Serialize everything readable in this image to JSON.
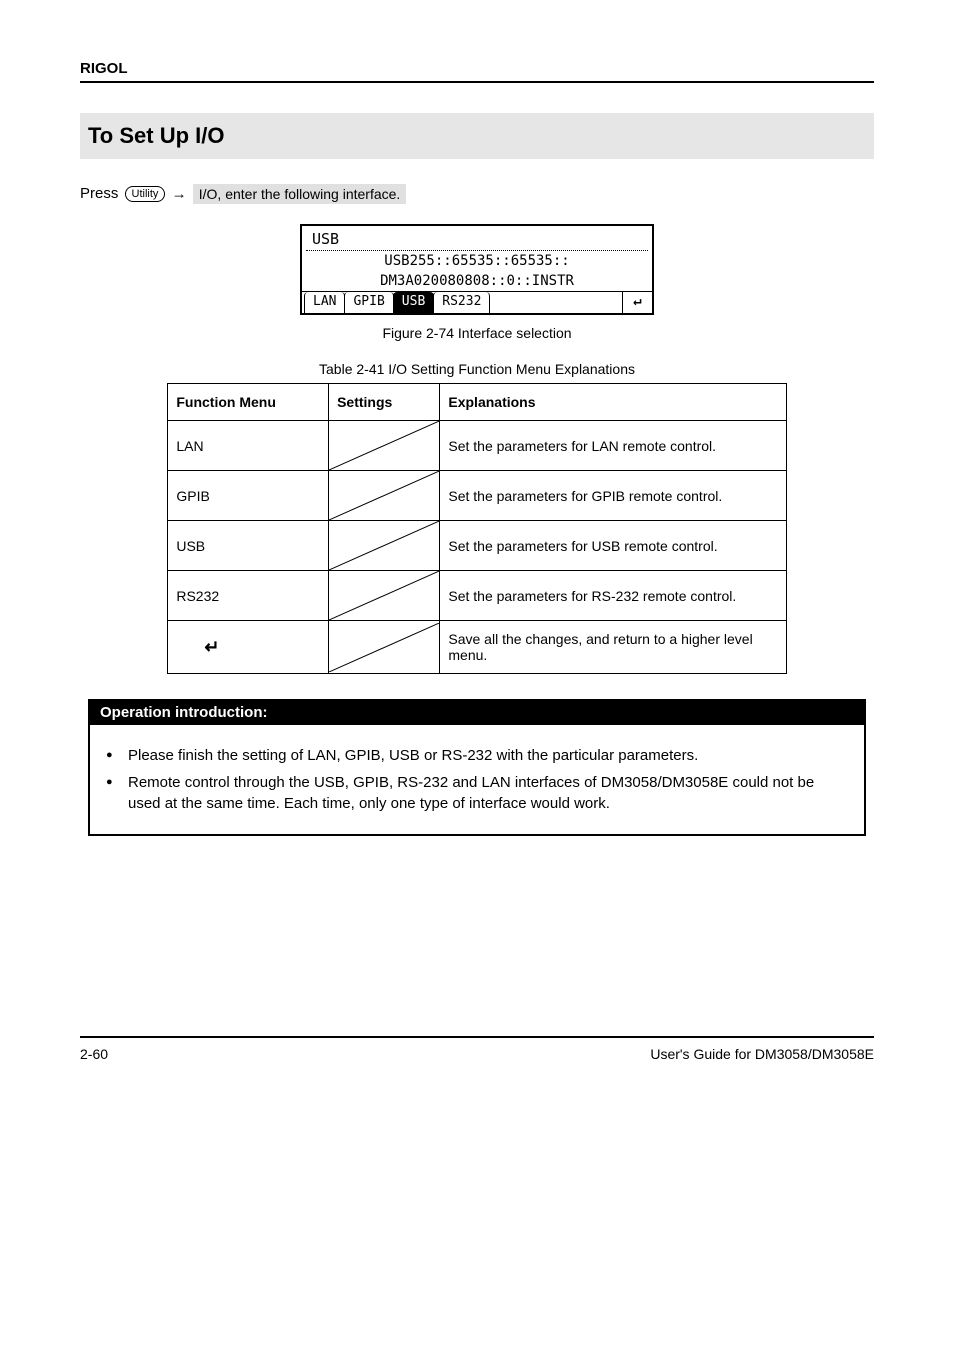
{
  "header": {
    "brand": "RIGOL"
  },
  "section_title": "To Set Up I/O",
  "press_line": {
    "pre": "Press ",
    "btn": "Utility",
    "post": " I/O, enter the following interface."
  },
  "screen": {
    "usb_label": "USB",
    "line1": "USB255::65535::65535::",
    "line2": "DM3A020080808::0::INSTR",
    "tabs": [
      "LAN",
      "GPIB",
      "USB",
      "RS232"
    ],
    "active_tab_index": 2
  },
  "figure_caption": "Figure 2-74 Interface selection",
  "table_caption": "Table 2-41 I/O Setting Function Menu Explanations",
  "table": {
    "headers": [
      "Function Menu",
      "Settings",
      "Explanations"
    ],
    "rows": [
      {
        "fn": "LAN",
        "exp": "Set the parameters for LAN remote control."
      },
      {
        "fn": "GPIB",
        "exp": "Set the parameters for GPIB remote control."
      },
      {
        "fn": "USB",
        "exp": "Set the parameters for USB remote control."
      },
      {
        "fn": "RS232",
        "exp": "Set the parameters for RS-232 remote control."
      },
      {
        "fn": "return-symbol",
        "exp": "Save all the changes, and return to a higher level menu."
      }
    ]
  },
  "note": {
    "title": "Operation introduction:",
    "lines": [
      "Please finish the setting of LAN, GPIB, USB or RS-232 with the particular parameters.",
      "Remote control through the USB, GPIB, RS-232 and LAN interfaces of DM3058/DM3058E could not be used at the same time. Each time, only one type of interface would work."
    ]
  },
  "footer": {
    "page": "2-60",
    "doc": "User's Guide for DM3058/DM3058E"
  }
}
